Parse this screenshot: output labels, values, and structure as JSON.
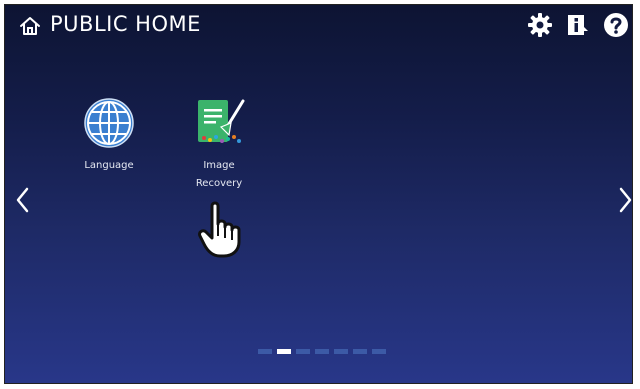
{
  "header": {
    "title": "PUBLIC HOME",
    "home_icon": "home-icon",
    "actions": [
      {
        "name": "settings",
        "icon": "gear-icon"
      },
      {
        "name": "info",
        "icon": "info-icon"
      },
      {
        "name": "help",
        "icon": "help-icon"
      }
    ]
  },
  "apps": [
    {
      "label_line1": "Language",
      "label_line2": "",
      "icon": "globe-icon"
    },
    {
      "label_line1": "Image",
      "label_line2": "Recovery",
      "icon": "image-recovery-icon"
    }
  ],
  "navigation": {
    "left_icon": "chevron-left-icon",
    "right_icon": "chevron-right-icon"
  },
  "pager": {
    "page_count": 7,
    "current_page": 2
  },
  "colors": {
    "background_top": "#0d1433",
    "background_bottom": "#283789",
    "globe": "#3a7fd0",
    "recovery_tile": "#3bb36b",
    "pager_inactive": "#3c5aa6",
    "pager_active": "#ffffff"
  },
  "pointer": "hand-pointer-icon"
}
